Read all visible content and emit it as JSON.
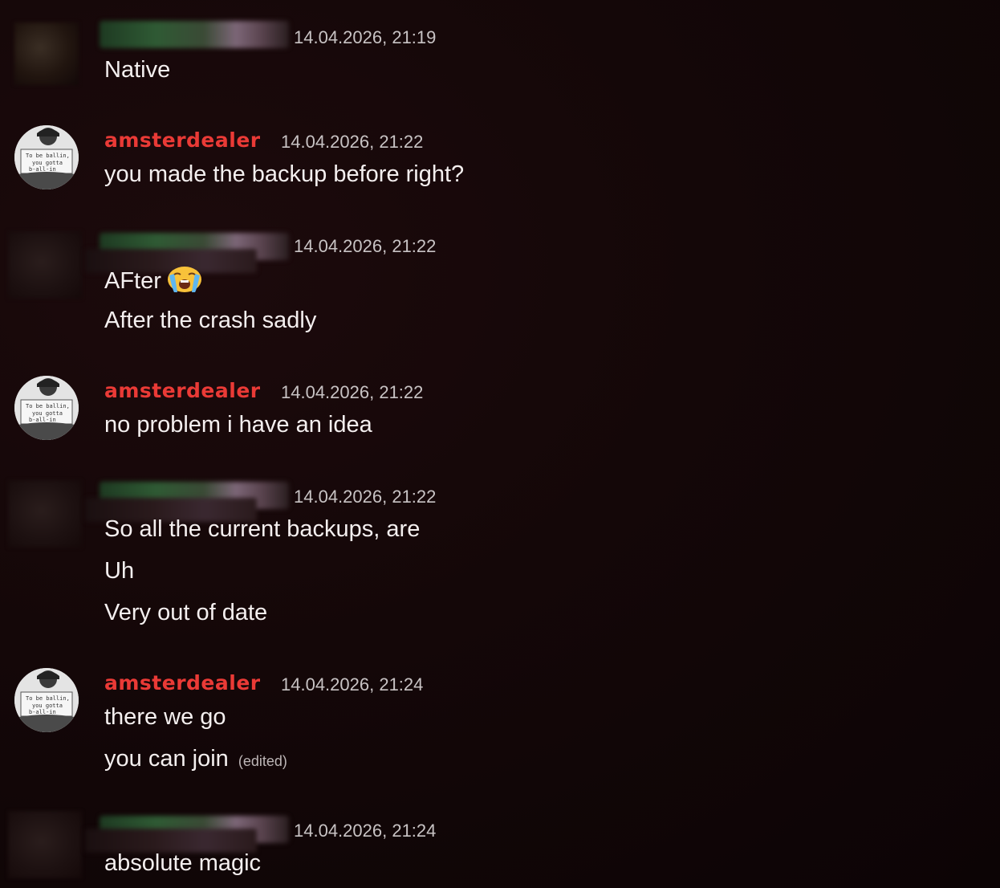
{
  "messages": [
    {
      "author_blurred": true,
      "timestamp": "14.04.2026, 21:19",
      "lines": [
        "Native"
      ]
    },
    {
      "author": "amsterdealer",
      "avatar_caption": [
        "To be ballin,",
        "you gotta",
        "b-all-in"
      ],
      "timestamp": "14.04.2026, 21:22",
      "lines": [
        "you made the backup before right?"
      ]
    },
    {
      "author_blurred": true,
      "timestamp": "14.04.2026, 21:22",
      "lines": [
        "AFter",
        "After the crash sadly"
      ],
      "emoji": "loudly-crying-face-emoji"
    },
    {
      "author": "amsterdealer",
      "avatar_caption": [
        "To be ballin,",
        "you gotta",
        "b-all-in"
      ],
      "timestamp": "14.04.2026, 21:22",
      "lines": [
        "no problem i have an idea"
      ]
    },
    {
      "author_blurred": true,
      "timestamp": "14.04.2026, 21:22",
      "lines": [
        "So all the current backups, are",
        "Uh",
        "Very out of date"
      ]
    },
    {
      "author": "amsterdealer",
      "avatar_caption": [
        "To be ballin,",
        "you gotta",
        "b-all-in"
      ],
      "timestamp": "14.04.2026, 21:24",
      "lines": [
        "there we go",
        "you can join"
      ],
      "edited_label": "(edited)"
    },
    {
      "author_blurred": true,
      "timestamp": "14.04.2026, 21:24",
      "lines": [
        "absolute magic"
      ]
    }
  ],
  "colors": {
    "username": "#ea3a36",
    "timestamp": "#c8c3c4",
    "text": "#f4efef",
    "background": "#140708"
  }
}
